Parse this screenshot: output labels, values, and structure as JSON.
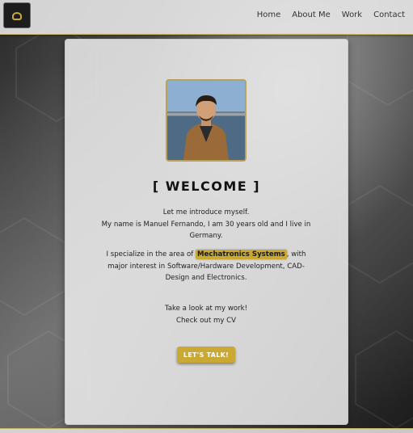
{
  "nav": {
    "logo_icon": "logo-badge",
    "links": [
      {
        "label": "Home"
      },
      {
        "label": "About Me"
      },
      {
        "label": "Work"
      },
      {
        "label": "Contact"
      }
    ]
  },
  "hero": {
    "photo_alt": "profile-photo",
    "title": "[ WELCOME ]",
    "intro_line1": "Let me introduce myself.",
    "intro_line2": "My name is Manuel Fernando, I am 30 years old and I live in Germany.",
    "spec_before": "I specialize in the area of ",
    "spec_highlight": "Mechatronics Systems",
    "spec_after": ", with major interest in Software/Hardware Development, CAD-Design and Electronics.",
    "cta_line1": "Take a look at my work!",
    "cta_line2": "Check out my CV",
    "button_label": "LET'S TALK!"
  },
  "colors": {
    "accent": "#c9a834",
    "card": "#ececec",
    "text": "#222222"
  }
}
